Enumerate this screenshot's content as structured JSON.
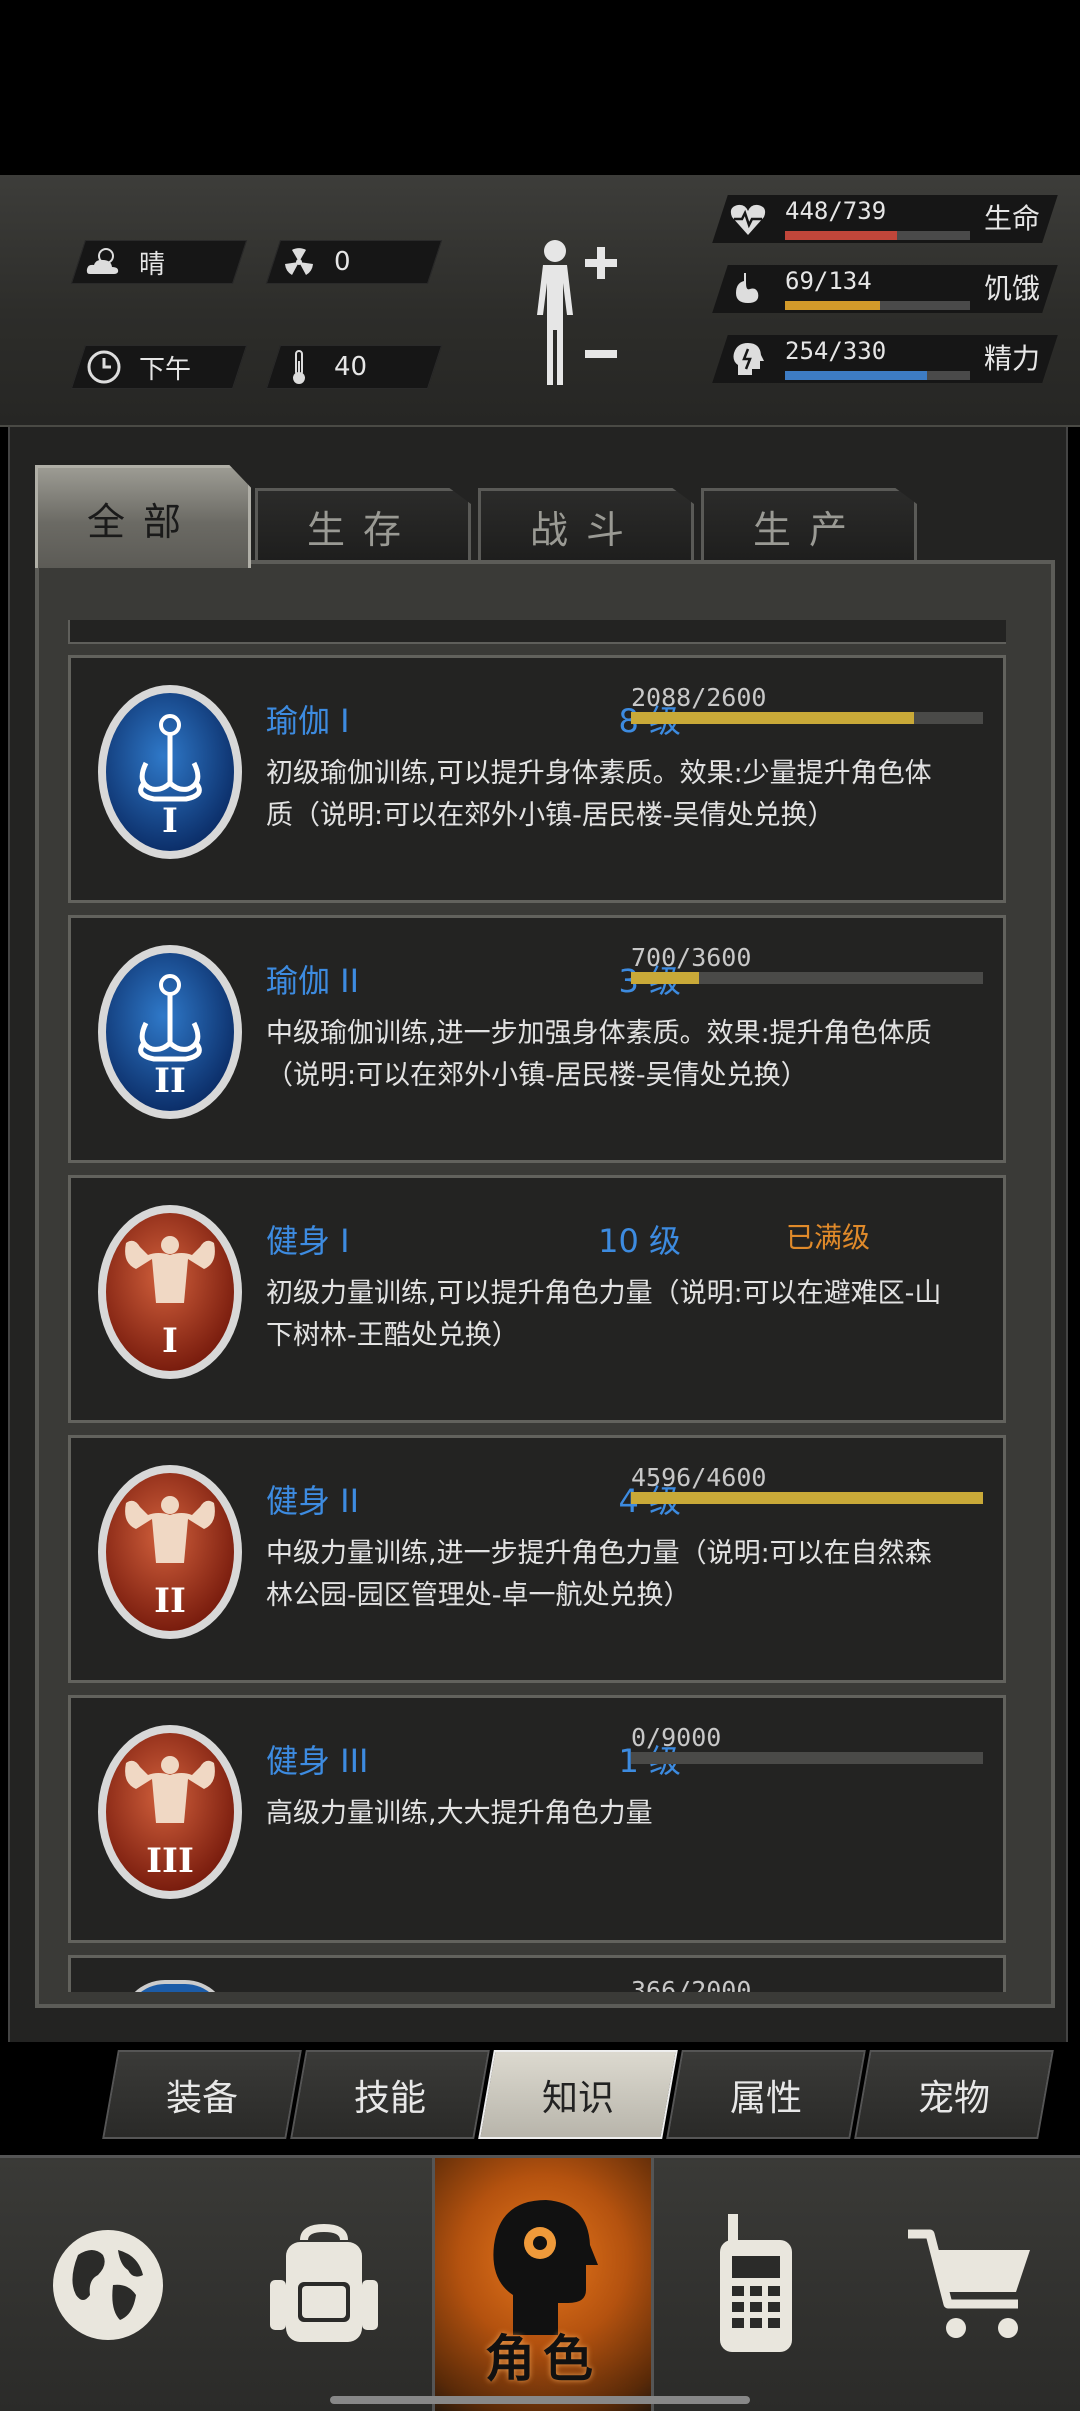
{
  "status": {
    "weather": "晴",
    "radiation": "0",
    "time_of_day": "下午",
    "temperature": "40",
    "stats": [
      {
        "value": "448/739",
        "label": "生命",
        "fraction": 0.606,
        "color": "#c0463a",
        "icon": "heart-icon"
      },
      {
        "value": "69/134",
        "label": "饥饿",
        "fraction": 0.515,
        "color": "#d29a2a",
        "icon": "stomach-icon"
      },
      {
        "value": "254/330",
        "label": "精力",
        "fraction": 0.77,
        "color": "#3d7cc4",
        "icon": "head-icon"
      }
    ]
  },
  "tabs": [
    "全部",
    "生存",
    "战斗",
    "生产"
  ],
  "active_tab": "全部",
  "skills": [
    {
      "name": "瑜伽 I",
      "level": "8 级",
      "progress": "2088/2600",
      "fraction": 0.803,
      "desc": "初级瑜伽训练,可以提升身体素质。效果:少量提升角色体质（说明:可以在郊外小镇-居民楼-吴倩处兑换）",
      "icon": "yoga-medal-icon",
      "numeral": "I"
    },
    {
      "name": "瑜伽 II",
      "level": "3 级",
      "progress": "700/3600",
      "fraction": 0.194,
      "desc": "中级瑜伽训练,进一步加强身体素质。效果:提升角色体质（说明:可以在郊外小镇-居民楼-吴倩处兑换）",
      "icon": "yoga-medal-icon",
      "numeral": "II"
    },
    {
      "name": "健身 I",
      "level": "10 级",
      "maxed": "已满级",
      "desc": "初级力量训练,可以提升角色力量（说明:可以在避难区-山下树林-王酷处兑换）",
      "icon": "fitness-medal-icon",
      "numeral": "I"
    },
    {
      "name": "健身 II",
      "level": "4 级",
      "progress": "4596/4600",
      "fraction": 0.999,
      "desc": "中级力量训练,进一步提升角色力量（说明:可以在自然森林公园-园区管理处-卓一航处兑换）",
      "icon": "fitness-medal-icon",
      "numeral": "II"
    },
    {
      "name": "健身 III",
      "level": "1 级",
      "progress": "0/9000",
      "fraction": 0,
      "desc": "高级力量训练,大大提升角色力量",
      "icon": "fitness-medal-icon",
      "numeral": "III"
    }
  ],
  "partial_card_progress": "366/2000",
  "subtabs": [
    "装备",
    "技能",
    "知识",
    "属性",
    "宠物"
  ],
  "active_subtab": "知识",
  "nav": {
    "active_label": "角色",
    "items": [
      "globe-icon",
      "backpack-icon",
      "character-icon",
      "walkie-talkie-icon",
      "cart-icon"
    ]
  }
}
